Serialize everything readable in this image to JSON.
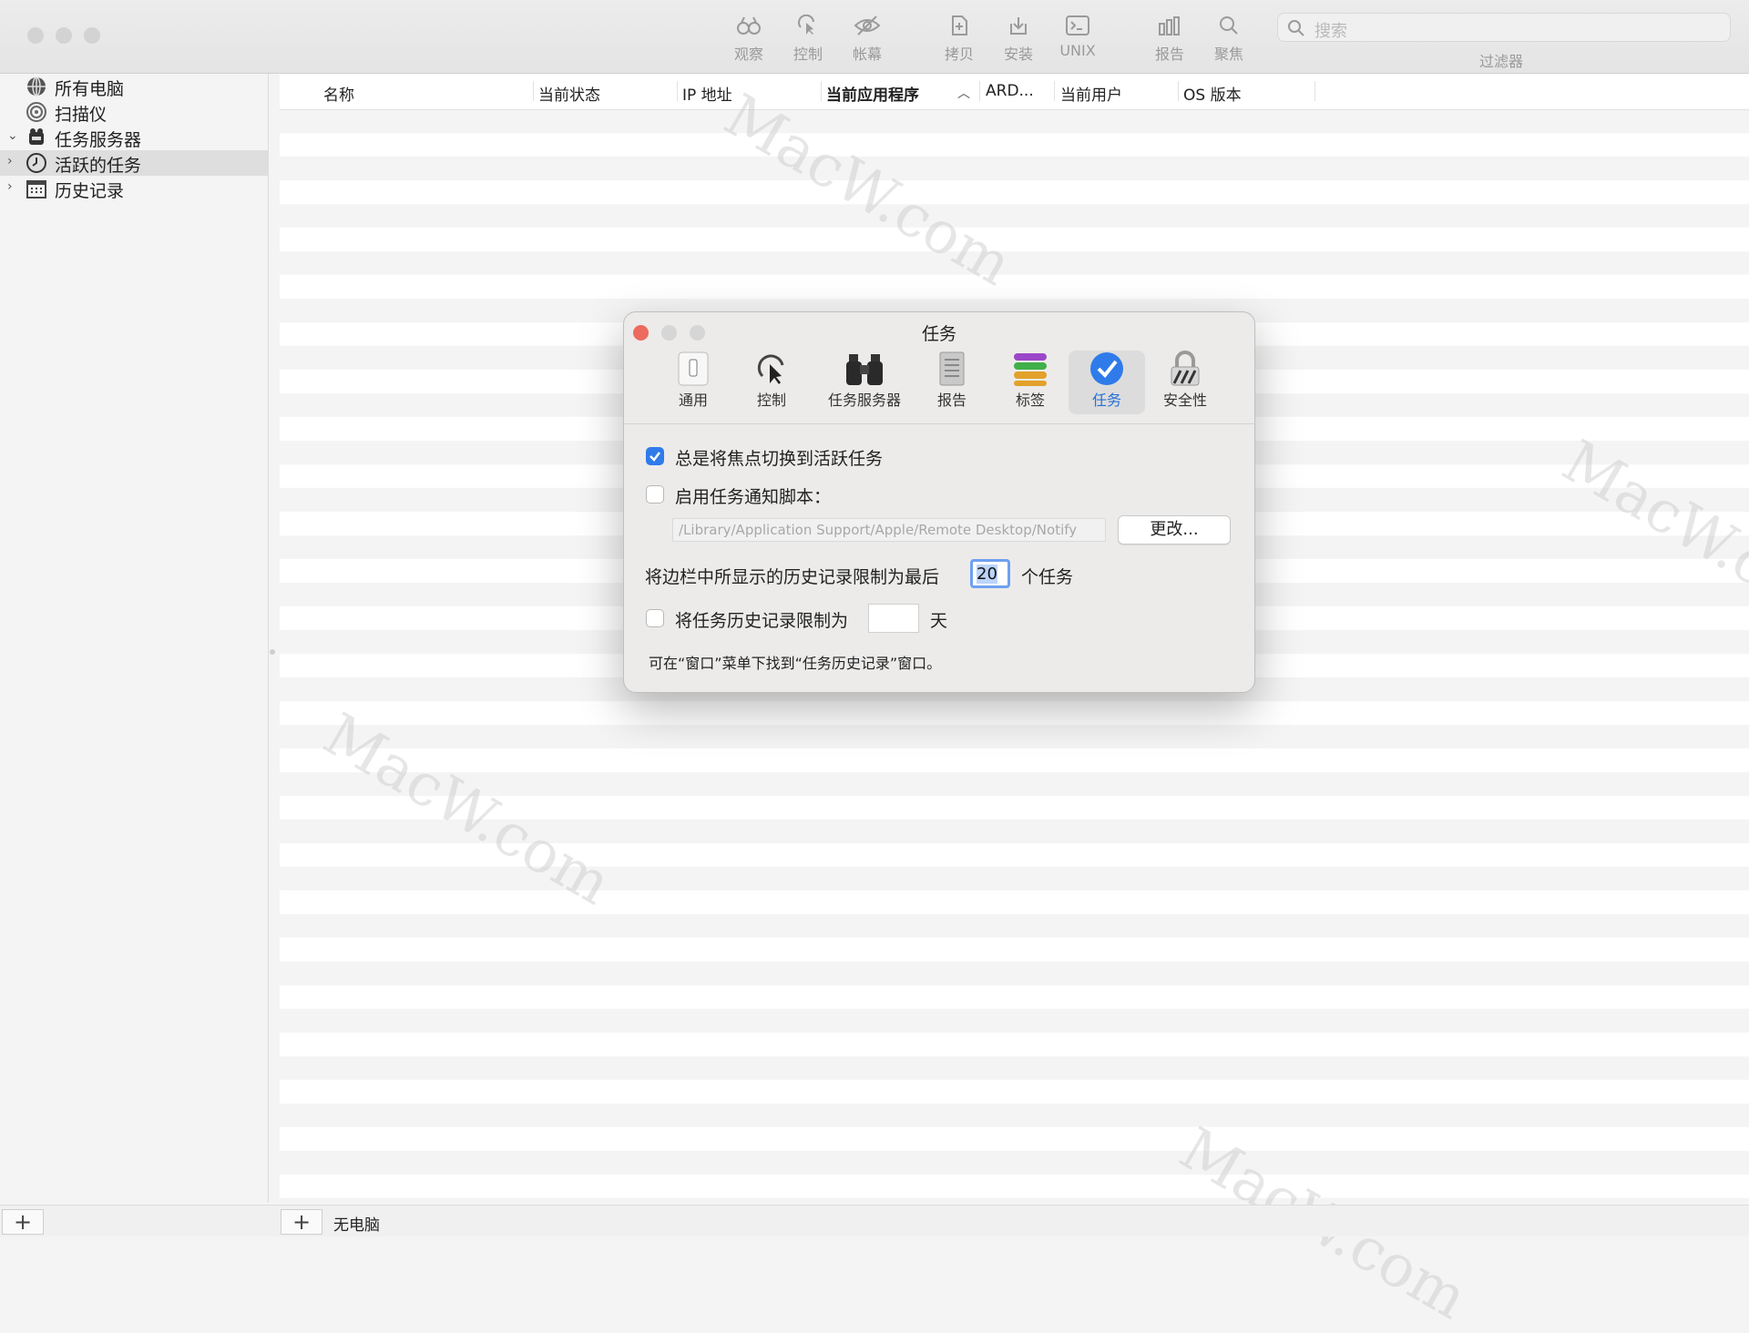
{
  "toolbar": {
    "items": [
      {
        "label": "观察",
        "icon": "binoculars-icon"
      },
      {
        "label": "控制",
        "icon": "control-cursor-icon"
      },
      {
        "label": "帐幕",
        "icon": "eye-slash-icon"
      },
      {
        "label": "拷贝",
        "icon": "copy-document-icon"
      },
      {
        "label": "安装",
        "icon": "install-icon"
      },
      {
        "label": "UNIX",
        "icon": "terminal-icon"
      },
      {
        "label": "报告",
        "icon": "report-chart-icon"
      },
      {
        "label": "聚焦",
        "icon": "spotlight-icon"
      }
    ],
    "search_placeholder": "搜索",
    "filter_label": "过滤器"
  },
  "sidebar": {
    "items": [
      {
        "label": "所有电脑",
        "icon": "globe-icon"
      },
      {
        "label": "扫描仪",
        "icon": "radar-icon"
      },
      {
        "label": "任务服务器",
        "icon": "task-server-icon"
      },
      {
        "label": "活跃的任务",
        "icon": "clock-icon"
      },
      {
        "label": "历史记录",
        "icon": "calendar-icon"
      }
    ]
  },
  "table": {
    "columns": [
      "名称",
      "当前状态",
      "IP 地址",
      "当前应用程序",
      "ARD...",
      "当前用户",
      "OS 版本"
    ]
  },
  "bottom_bar": {
    "plus_label": "+",
    "computer_count": "无电脑"
  },
  "dialog": {
    "title": "任务",
    "tabs": [
      {
        "label": "通用",
        "icon": "switch-icon"
      },
      {
        "label": "控制",
        "icon": "control-cursor-icon"
      },
      {
        "label": "任务服务器",
        "icon": "binoculars-icon"
      },
      {
        "label": "报告",
        "icon": "report-document-icon"
      },
      {
        "label": "标签",
        "icon": "tags-stack-icon"
      },
      {
        "label": "任务",
        "icon": "checkmark-circle-icon"
      },
      {
        "label": "安全性",
        "icon": "lock-icon"
      }
    ],
    "focus_active_task_label": "总是将焦点切换到活跃任务",
    "enable_script_label": "启用任务通知脚本：",
    "script_path": "/Library/Application Support/Apple/Remote Desktop/Notify",
    "change_button": "更改...",
    "history_limit_prefix": "将边栏中所显示的历史记录限制为最后",
    "history_limit_value": "20",
    "history_limit_suffix": "个任务",
    "history_days_label": "将任务历史记录限制为",
    "history_days_unit": "天",
    "hint": "可在“窗口”菜单下找到“任务历史记录”窗口。"
  },
  "watermark": "MacW.com",
  "colors": {
    "accent": "#2f7bea",
    "close": "#ed6a5e",
    "selection": "#dedede"
  }
}
